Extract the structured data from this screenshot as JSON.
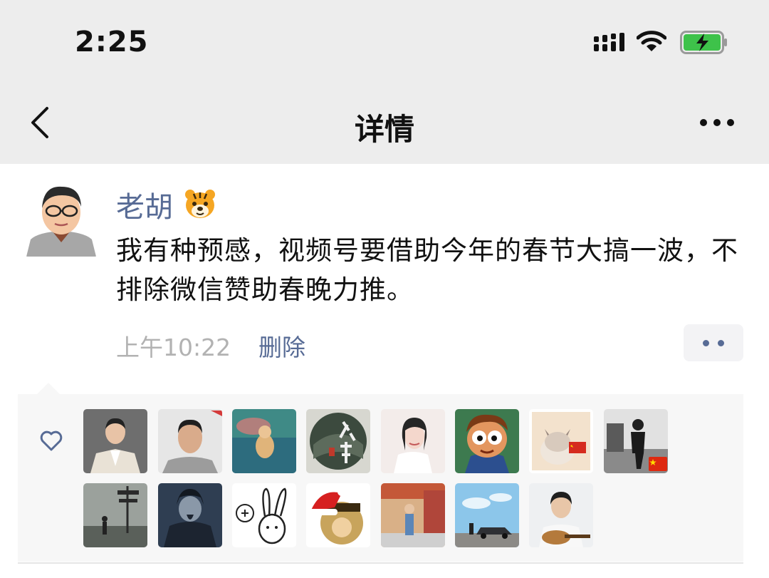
{
  "status_bar": {
    "time": "2:25"
  },
  "nav": {
    "title": "详情"
  },
  "post": {
    "author": "老胡",
    "text": "我有种预感，视频号要借助今年的春节大搞一波，不排除微信赞助春晚力推。",
    "time": "上午10:22",
    "delete_label": "删除"
  },
  "likes": {
    "icon": "heart-outline-icon",
    "count": 15
  },
  "colors": {
    "link": "#576b95",
    "nav_bg": "#ededed",
    "likes_bg": "#f7f7f7"
  }
}
